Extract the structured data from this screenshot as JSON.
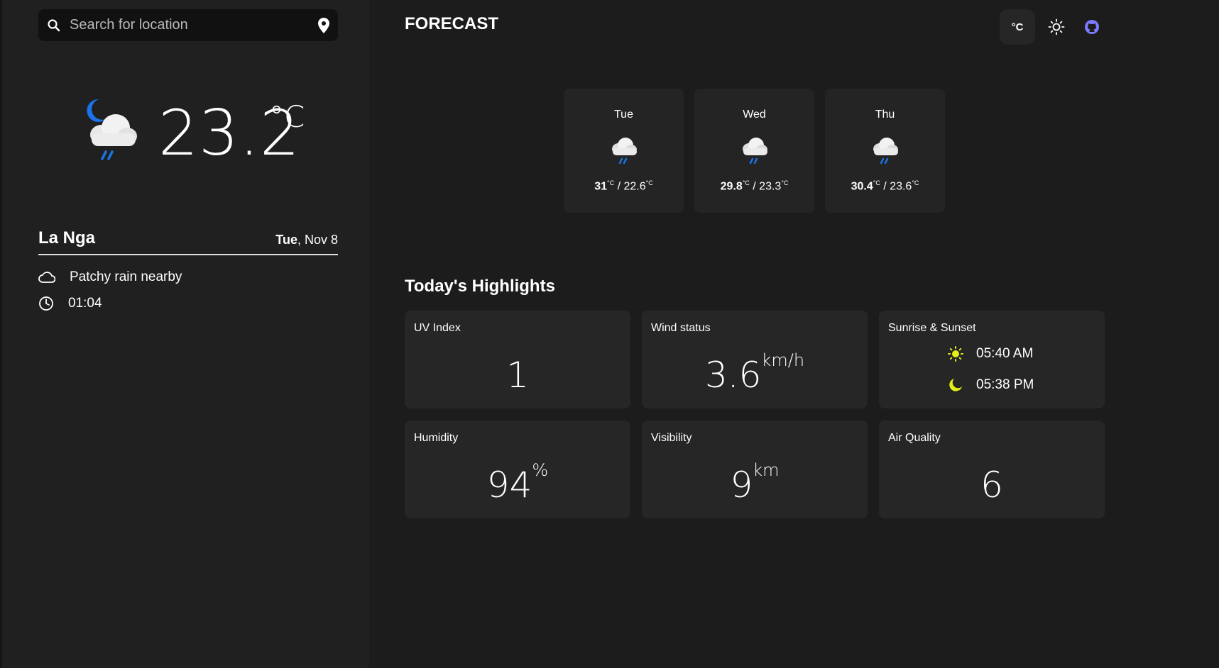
{
  "search": {
    "placeholder": "Search for location"
  },
  "current": {
    "temperature": "23.2",
    "unit": "°C",
    "location": "La Nga",
    "day": "Tue",
    "date": ", Nov 8",
    "condition": "Patchy rain nearby",
    "time": "01:04"
  },
  "header": {
    "title": "FORECAST",
    "unit_toggle": "°C"
  },
  "forecast": [
    {
      "day": "Tue",
      "high": "31",
      "low": "22.6",
      "unit": "°C"
    },
    {
      "day": "Wed",
      "high": "29.8",
      "low": "23.3",
      "unit": "°C"
    },
    {
      "day": "Thu",
      "high": "30.4",
      "low": "23.6",
      "unit": "°C"
    }
  ],
  "highlights": {
    "title": "Today's Highlights",
    "uv": {
      "label": "UV Index",
      "value": "1"
    },
    "wind": {
      "label": "Wind status",
      "value": "3.6",
      "unit": "km/h"
    },
    "sun": {
      "label": "Sunrise & Sunset",
      "sunrise": "05:40 AM",
      "sunset": "05:38 PM"
    },
    "humidity": {
      "label": "Humidity",
      "value": "94",
      "unit": "%"
    },
    "visibility": {
      "label": "Visibility",
      "value": "9",
      "unit": "km"
    },
    "air": {
      "label": "Air Quality",
      "value": "6"
    }
  },
  "colors": {
    "accent_blue": "#1a73e8",
    "sun_yellow": "#e5ee17",
    "github_purple": "#7b7bff"
  }
}
